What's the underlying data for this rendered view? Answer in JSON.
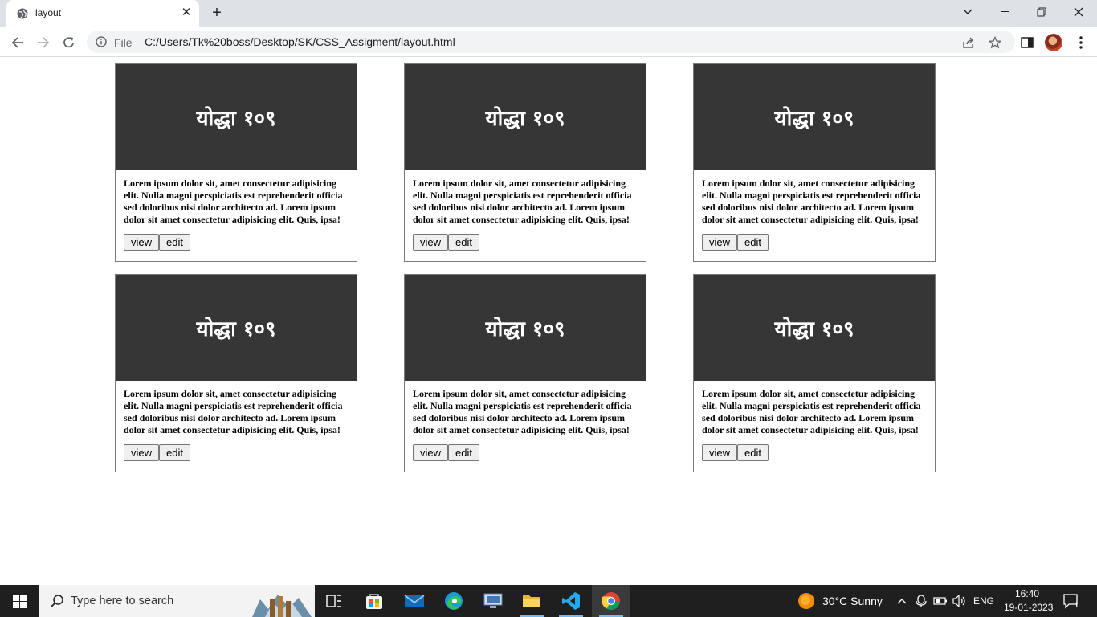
{
  "browser": {
    "tab_title": "layout",
    "file_label": "File",
    "url": "C:/Users/Tk%20boss/Desktop/SK/CSS_Assigment/layout.html"
  },
  "cards": [
    {
      "title": "योद्धा १०९",
      "text": "Lorem ipsum dolor sit, amet consectetur adipisicing elit. Nulla magni perspiciatis est reprehenderit officia sed doloribus nisi dolor architecto ad. Lorem ipsum dolor sit amet consectetur adipisicing elit. Quis, ipsa!",
      "view_label": "view",
      "edit_label": "edit"
    },
    {
      "title": "योद्धा १०९",
      "text": "Lorem ipsum dolor sit, amet consectetur adipisicing elit. Nulla magni perspiciatis est reprehenderit officia sed doloribus nisi dolor architecto ad. Lorem ipsum dolor sit amet consectetur adipisicing elit. Quis, ipsa!",
      "view_label": "view",
      "edit_label": "edit"
    },
    {
      "title": "योद्धा १०९",
      "text": "Lorem ipsum dolor sit, amet consectetur adipisicing elit. Nulla magni perspiciatis est reprehenderit officia sed doloribus nisi dolor architecto ad. Lorem ipsum dolor sit amet consectetur adipisicing elit. Quis, ipsa!",
      "view_label": "view",
      "edit_label": "edit"
    },
    {
      "title": "योद्धा १०९",
      "text": "Lorem ipsum dolor sit, amet consectetur adipisicing elit. Nulla magni perspiciatis est reprehenderit officia sed doloribus nisi dolor architecto ad. Lorem ipsum dolor sit amet consectetur adipisicing elit. Quis, ipsa!",
      "view_label": "view",
      "edit_label": "edit"
    },
    {
      "title": "योद्धा १०९",
      "text": "Lorem ipsum dolor sit, amet consectetur adipisicing elit. Nulla magni perspiciatis est reprehenderit officia sed doloribus nisi dolor architecto ad. Lorem ipsum dolor sit amet consectetur adipisicing elit. Quis, ipsa!",
      "view_label": "view",
      "edit_label": "edit"
    },
    {
      "title": "योद्धा १०९",
      "text": "Lorem ipsum dolor sit, amet consectetur adipisicing elit. Nulla magni perspiciatis est reprehenderit officia sed doloribus nisi dolor architecto ad. Lorem ipsum dolor sit amet consectetur adipisicing elit. Quis, ipsa!",
      "view_label": "view",
      "edit_label": "edit"
    }
  ],
  "taskbar": {
    "search_placeholder": "Type here to search",
    "weather": "30°C  Sunny",
    "language": "ENG",
    "time": "16:40",
    "date": "19-01-2023",
    "notification_count": "1"
  },
  "colors": {
    "card_banner": "#363636",
    "tabbar": "#dee1e6",
    "taskbar": "#1f1f1f"
  }
}
